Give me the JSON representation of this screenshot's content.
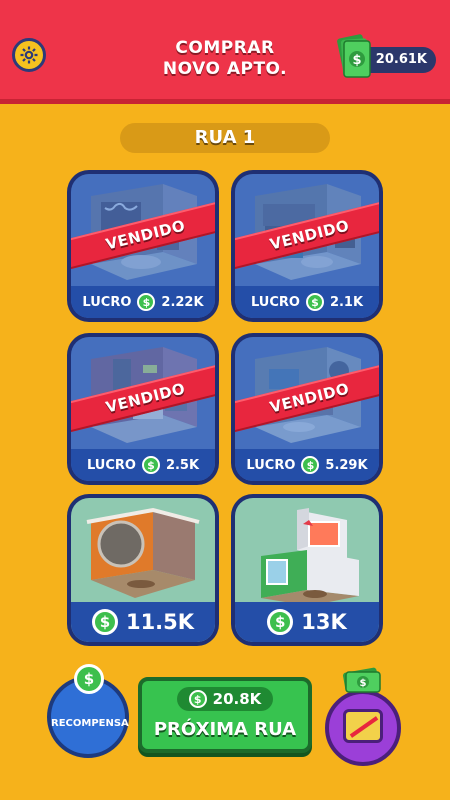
{
  "header": {
    "title_line1": "COMPRAR",
    "title_line2": "NOVO APTO.",
    "money": "20.61K"
  },
  "street": {
    "name": "RUA 1"
  },
  "apartments": [
    {
      "status": "VENDIDO",
      "profit_label": "LUCRO",
      "profit": "2.22K"
    },
    {
      "status": "VENDIDO",
      "profit_label": "LUCRO",
      "profit": "2.1K"
    },
    {
      "status": "VENDIDO",
      "profit_label": "LUCRO",
      "profit": "2.5K"
    },
    {
      "status": "VENDIDO",
      "profit_label": "LUCRO",
      "profit": "5.29K"
    },
    {
      "price": "11.5K"
    },
    {
      "price": "13K"
    }
  ],
  "currency_symbol": "$",
  "bottom": {
    "reward_label": "RECOMPENSA",
    "next_cost": "20.8K",
    "next_label": "PRÓXIMA RUA"
  },
  "colors": {
    "background": "#f6b21b",
    "header": "#ee3449",
    "card_border": "#1f2f73",
    "sold_ribbon": "#e8263e",
    "money_green": "#37c34f"
  }
}
